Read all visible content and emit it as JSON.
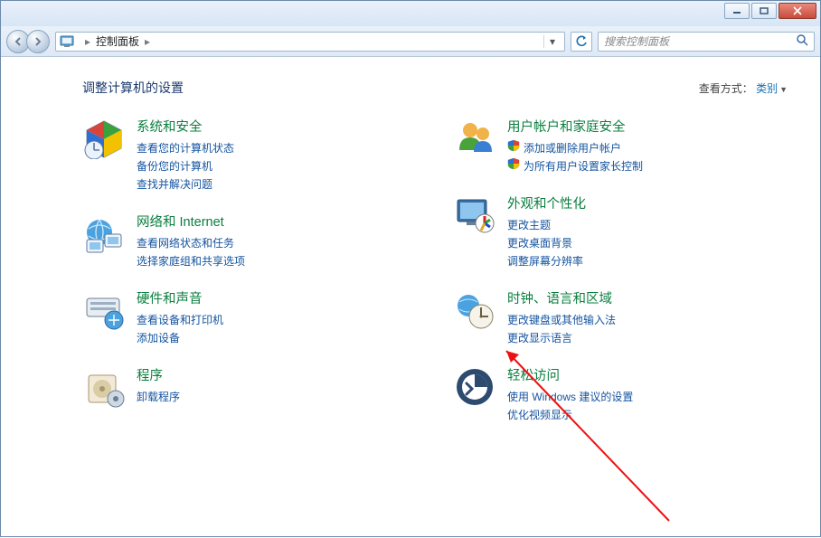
{
  "titlebar": {
    "min_tooltip": "最小化",
    "max_tooltip": "最大化",
    "close_tooltip": "关闭"
  },
  "nav": {
    "back_tooltip": "后退",
    "fwd_tooltip": "前进",
    "breadcrumb_root": "控制面板",
    "refresh_tooltip": "刷新",
    "search_placeholder": "搜索控制面板"
  },
  "header": {
    "title": "调整计算机的设置",
    "viewby_label": "查看方式：",
    "viewby_value": "类别"
  },
  "left": [
    {
      "title": "系统和安全",
      "subs": [
        {
          "label": "查看您的计算机状态",
          "shield": false
        },
        {
          "label": "备份您的计算机",
          "shield": false
        },
        {
          "label": "查找并解决问题",
          "shield": false
        }
      ]
    },
    {
      "title": "网络和 Internet",
      "subs": [
        {
          "label": "查看网络状态和任务",
          "shield": false
        },
        {
          "label": "选择家庭组和共享选项",
          "shield": false
        }
      ]
    },
    {
      "title": "硬件和声音",
      "subs": [
        {
          "label": "查看设备和打印机",
          "shield": false
        },
        {
          "label": "添加设备",
          "shield": false
        }
      ]
    },
    {
      "title": "程序",
      "subs": [
        {
          "label": "卸载程序",
          "shield": false
        }
      ]
    }
  ],
  "right": [
    {
      "title": "用户帐户和家庭安全",
      "subs": [
        {
          "label": "添加或删除用户帐户",
          "shield": true
        },
        {
          "label": "为所有用户设置家长控制",
          "shield": true
        }
      ]
    },
    {
      "title": "外观和个性化",
      "subs": [
        {
          "label": "更改主题",
          "shield": false
        },
        {
          "label": "更改桌面背景",
          "shield": false
        },
        {
          "label": "调整屏幕分辨率",
          "shield": false
        }
      ]
    },
    {
      "title": "时钟、语言和区域",
      "subs": [
        {
          "label": "更改键盘或其他输入法",
          "shield": false
        },
        {
          "label": "更改显示语言",
          "shield": false
        }
      ]
    },
    {
      "title": "轻松访问",
      "subs": [
        {
          "label": "使用 Windows 建议的设置",
          "shield": false
        },
        {
          "label": "优化视频显示",
          "shield": false
        }
      ]
    }
  ]
}
